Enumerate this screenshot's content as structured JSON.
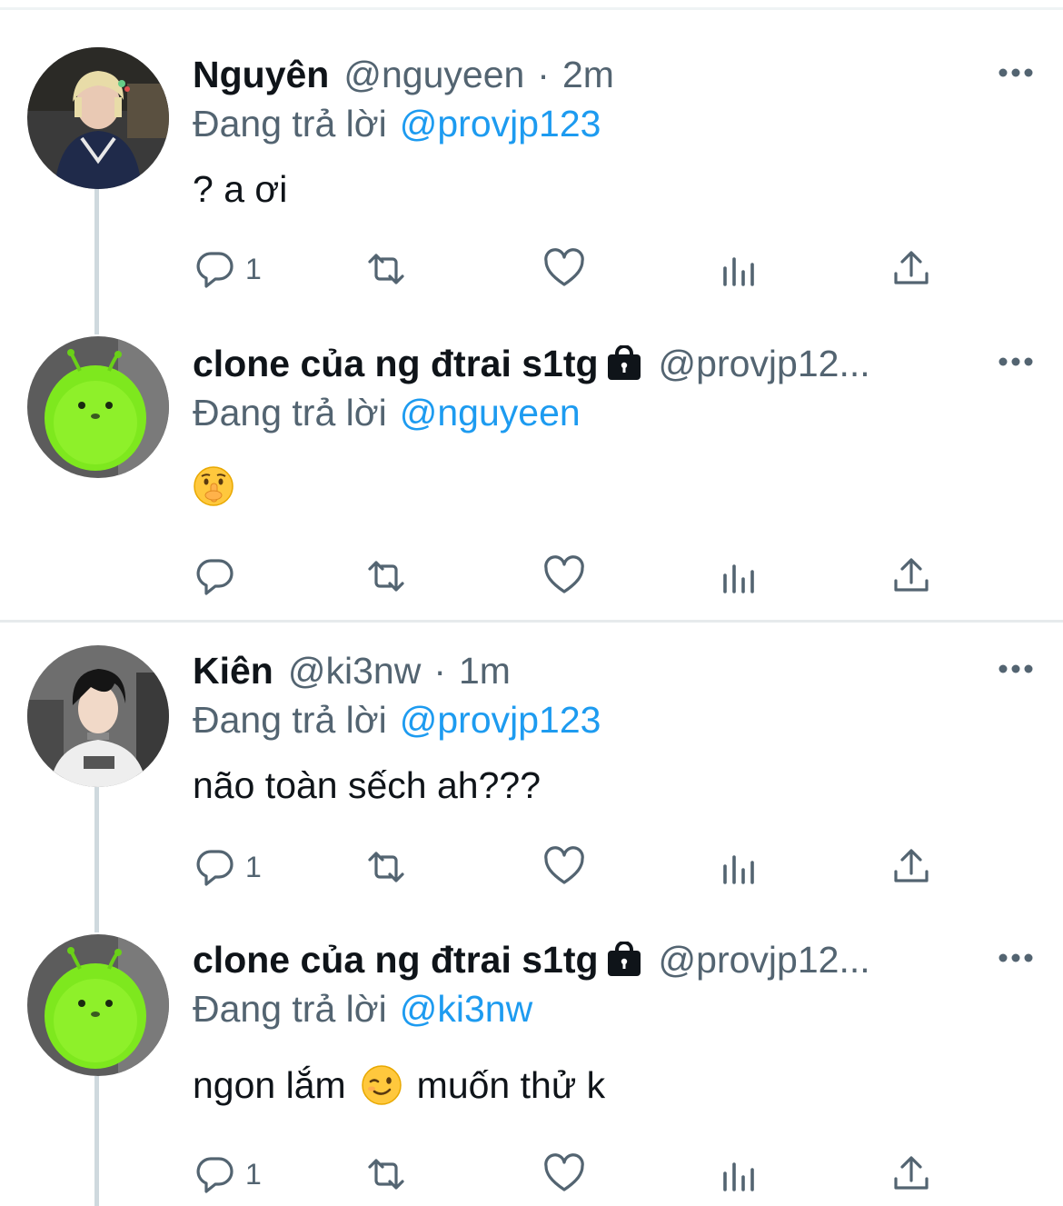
{
  "tweets": [
    {
      "display_name": "Nguyên",
      "handle": "@nguyeen",
      "separator": "·",
      "time": "2m",
      "reply_prefix": "Đang trả lời",
      "reply_to": "@provjp123",
      "text": "? a ơi",
      "reply_count": "1",
      "avatar": "blonde-person-avatar"
    },
    {
      "display_name": "clone của ng đtrai s1tg",
      "protected": true,
      "handle": "@provjp12...",
      "reply_prefix": "Đang trả lời",
      "reply_to": "@nguyeen",
      "text": "",
      "emoji": "shushing-face",
      "reply_count": "",
      "avatar": "green-hamster-avatar"
    },
    {
      "display_name": "Kiên",
      "handle": "@ki3nw",
      "separator": "·",
      "time": "1m",
      "reply_prefix": "Đang trả lời",
      "reply_to": "@provjp123",
      "text": "não toàn sếch ah???",
      "reply_count": "1",
      "avatar": "dark-hair-person-avatar"
    },
    {
      "display_name": "clone của ng đtrai s1tg",
      "protected": true,
      "handle": "@provjp12...",
      "reply_prefix": "Đang trả lời",
      "reply_to": "@ki3nw",
      "text_before": "ngon lắm",
      "emoji": "winking-face",
      "text_after": "muốn thử k",
      "reply_count": "1",
      "avatar": "green-hamster-avatar"
    }
  ],
  "icons": {
    "reply": "reply-icon",
    "retweet": "retweet-icon",
    "like": "heart-icon",
    "views": "views-icon",
    "share": "share-icon",
    "more": "more-icon",
    "lock": "lock-icon"
  },
  "colors": {
    "text": "#0f1419",
    "secondary": "#536471",
    "link": "#1d9bf0",
    "thread_line": "#cfd9de"
  }
}
